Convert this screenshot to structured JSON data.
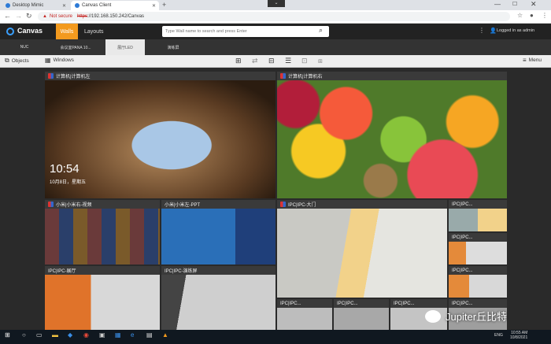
{
  "browser": {
    "tabs": [
      {
        "title": "Desktop Mimic"
      },
      {
        "title": "Canvas Client"
      }
    ],
    "new_tab": "+",
    "url": {
      "warning": "Not secure",
      "scheme": "https",
      "rest": "://192.168.150.242/Canvas"
    }
  },
  "app": {
    "logo": "Canvas",
    "nav": {
      "walls": "Walls",
      "layouts": "Layouts"
    },
    "search_placeholder": "Type Wall name to search and press Enter",
    "user": "Logged in as admin"
  },
  "wall_tabs": [
    "NUC",
    "会议室PANA 10...",
    "展厅LED",
    "演练屏"
  ],
  "toolbar": {
    "objects": "Objects",
    "windows": "Windows",
    "menu": "Menu"
  },
  "windows": [
    {
      "title": "计算机|计算机左",
      "time": "10:54",
      "date": "10月8日，星期五"
    },
    {
      "title": "计算机|计算机右"
    },
    {
      "title": "小米|小米右-视频"
    },
    {
      "title": "小米|小米左-PPT"
    },
    {
      "title": "IPC|IPC-大门"
    },
    {
      "title": "IPC|IPC..."
    },
    {
      "title": "IPC|IPC..."
    },
    {
      "title": "IPC|IPC-展厅"
    },
    {
      "title": "IPC|IPC-演练屏"
    },
    {
      "title": "IPC|IPC..."
    },
    {
      "title": "IPC|IPC..."
    },
    {
      "title": "IPC|IPC..."
    },
    {
      "title": "IPC|IPC..."
    },
    {
      "title": "IPC|IPC..."
    },
    {
      "title": "IPC|IPC..."
    }
  ],
  "taskbar": {
    "lang": "ENG",
    "time": "10:55 AM",
    "date": "10/8/2021"
  },
  "watermark": "Jupiter丘比特"
}
